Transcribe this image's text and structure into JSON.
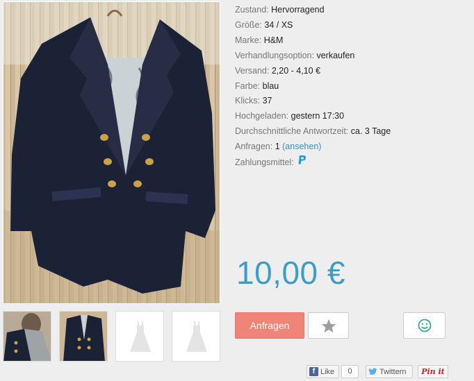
{
  "details": [
    {
      "key": "Zustand:",
      "value": "Hervorragend"
    },
    {
      "key": "Größe:",
      "value": "34 / XS"
    },
    {
      "key": "Marke:",
      "value": "H&M"
    },
    {
      "key": "Verhandlungsoption:",
      "value": "verkaufen"
    },
    {
      "key": "Versand:",
      "value": "2,20 - 4,10 €"
    },
    {
      "key": "Farbe:",
      "value": "blau"
    },
    {
      "key": "Klicks:",
      "value": "37"
    },
    {
      "key": "Hochgeladen:",
      "value": "gestern 17:30"
    },
    {
      "key": "Durchschnittliche Antwortzeit:",
      "value": "ca. 3 Tage"
    },
    {
      "key": "Anfragen:",
      "value": "1",
      "link": "(ansehen)"
    },
    {
      "key": "Zahlungsmittel:",
      "value": ""
    }
  ],
  "price": "10,00 €",
  "buttons": {
    "ask": "Anfragen"
  },
  "social": {
    "like": "Like",
    "like_count": "0",
    "twitter": "Twittern",
    "pinterest": "Pin it"
  },
  "icons": {
    "star": "star-icon",
    "smile": "smile-icon",
    "paypal": "paypal-icon"
  },
  "colors": {
    "price": "#3d9dc8",
    "ask_button": "#ee8577",
    "link": "#3a8ec2",
    "smile": "#3aaa8f"
  }
}
